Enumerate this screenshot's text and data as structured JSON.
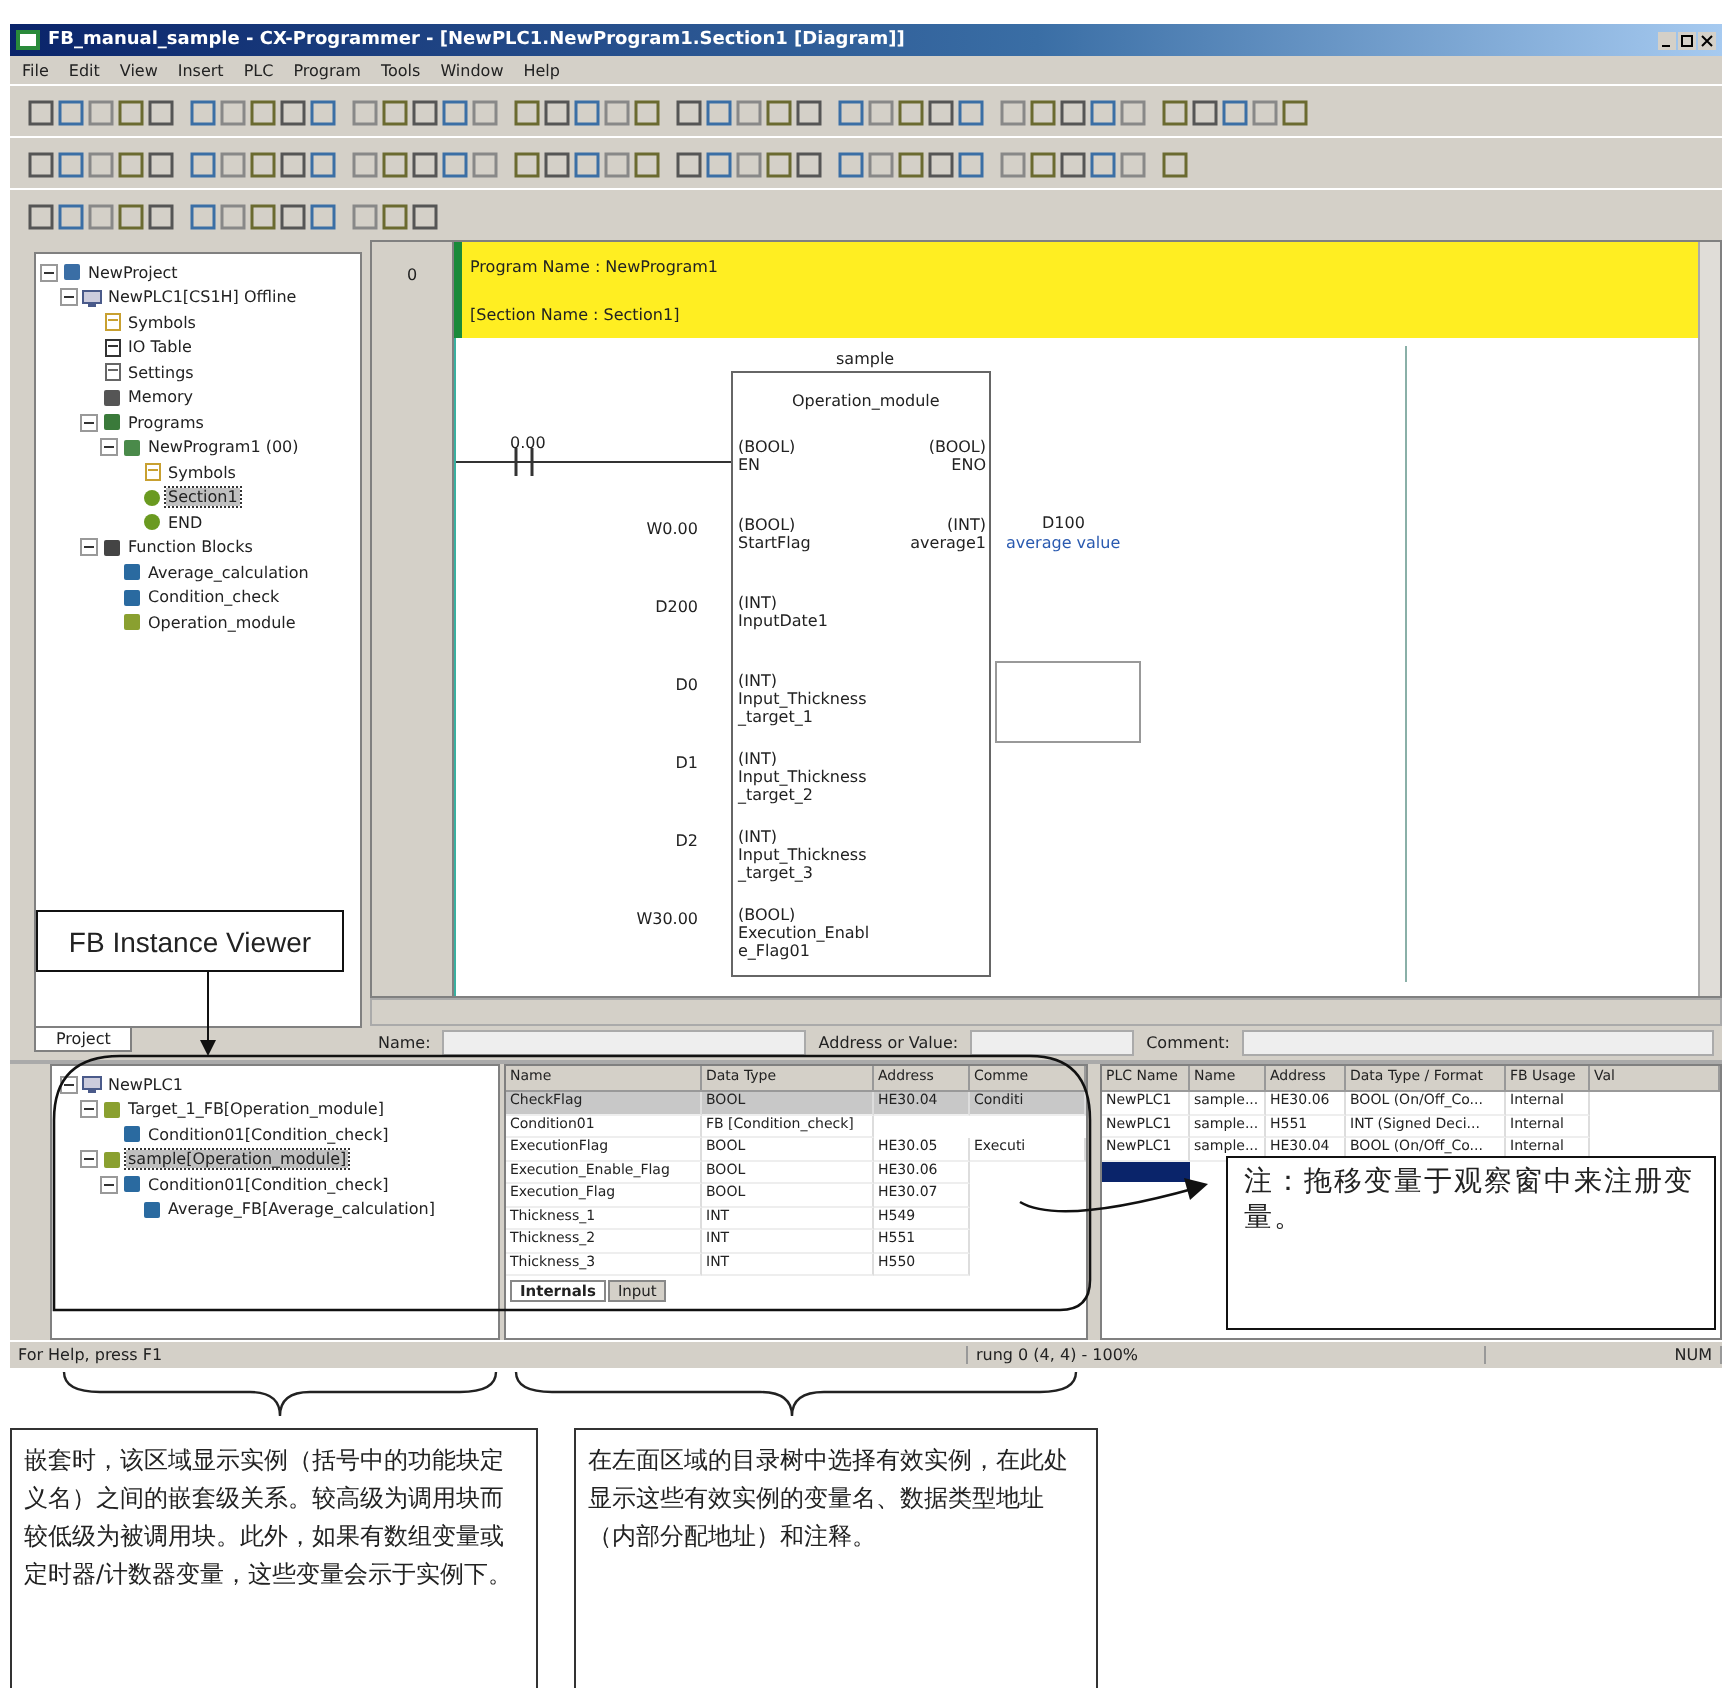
{
  "window": {
    "title": "FB_manual_sample - CX-Programmer - [NewPLC1.NewProgram1.Section1 [Diagram]]"
  },
  "menu": [
    "File",
    "Edit",
    "View",
    "Insert",
    "PLC",
    "Program",
    "Tools",
    "Window",
    "Help"
  ],
  "project_tree": [
    {
      "label": "NewProject",
      "kind": "project",
      "selected": false,
      "expanded": true,
      "children": [
        {
          "label": "NewPLC1[CS1H] Offline",
          "kind": "plc",
          "selected": false,
          "expanded": true,
          "children": [
            {
              "label": "Symbols",
              "kind": "symbols",
              "selected": false
            },
            {
              "label": "IO Table",
              "kind": "table",
              "selected": false
            },
            {
              "label": "Settings",
              "kind": "settings",
              "selected": false
            },
            {
              "label": "Memory",
              "kind": "memory",
              "selected": false
            },
            {
              "label": "Programs",
              "kind": "programs",
              "selected": false,
              "expanded": true,
              "children": [
                {
                  "label": "NewProgram1 (00)",
                  "kind": "program",
                  "selected": false,
                  "expanded": true,
                  "children": [
                    {
                      "label": "Symbols",
                      "kind": "symbols",
                      "selected": false
                    },
                    {
                      "label": "Section1",
                      "kind": "section",
                      "selected": true
                    },
                    {
                      "label": "END",
                      "kind": "section",
                      "selected": false
                    }
                  ]
                }
              ]
            },
            {
              "label": "Function Blocks",
              "kind": "fbfolder",
              "selected": false,
              "expanded": true,
              "children": [
                {
                  "label": "Average_calculation",
                  "kind": "fb",
                  "selected": false
                },
                {
                  "label": "Condition_check",
                  "kind": "fb",
                  "selected": false
                },
                {
                  "label": "Operation_module",
                  "kind": "fbmod",
                  "selected": false
                }
              ]
            }
          ]
        }
      ]
    }
  ],
  "project_tab": "Project",
  "diagram": {
    "program_name": "Program Name : NewProgram1",
    "section_name": "[Section Name : Section1]",
    "rung_number": "0",
    "contact_address": "0.00",
    "block": {
      "instance": "sample",
      "fb_name": "Operation_module",
      "inputs": [
        {
          "type": "(BOOL)",
          "name": "EN"
        },
        {
          "operand": "W0.00",
          "type": "(BOOL)",
          "name": "StartFlag"
        },
        {
          "operand": "D200",
          "type": "(INT)",
          "name": "InputDate1"
        },
        {
          "operand": "D0",
          "type": "(INT)",
          "name": "Input_Thickness_target_1"
        },
        {
          "operand": "D1",
          "type": "(INT)",
          "name": "Input_Thickness_target_2"
        },
        {
          "operand": "D2",
          "type": "(INT)",
          "name": "Input_Thickness_target_3"
        },
        {
          "operand": "W30.00",
          "type": "(BOOL)",
          "name": "Execution_Enable_Flag01"
        }
      ],
      "outputs": [
        {
          "type": "(BOOL)",
          "name": "ENO"
        },
        {
          "type": "(INT)",
          "name": "average1",
          "operand": "D100",
          "comment": "average value"
        }
      ]
    }
  },
  "entry_bar": {
    "name_label": "Name:",
    "address_label": "Address or Value:",
    "comment_label": "Comment:"
  },
  "instance_tree": [
    {
      "label": "NewPLC1",
      "kind": "plc",
      "selected": false,
      "expanded": true,
      "children": [
        {
          "label": "Target_1_FB[Operation_module]",
          "kind": "fbmod",
          "selected": false,
          "expanded": true,
          "children": [
            {
              "label": "Condition01[Condition_check]",
              "kind": "fb",
              "selected": false
            }
          ]
        },
        {
          "label": "sample[Operation_module]",
          "kind": "fbmod",
          "selected": true,
          "expanded": true,
          "children": [
            {
              "label": "Condition01[Condition_check]",
              "kind": "fb",
              "selected": false,
              "expanded": true,
              "children": [
                {
                  "label": "Average_FB[Average_calculation]",
                  "kind": "fb",
                  "selected": false
                }
              ]
            }
          ]
        }
      ]
    }
  ],
  "variables": {
    "columns": [
      "Name",
      "Data Type",
      "Address",
      "Comme"
    ],
    "rows": [
      {
        "cells": [
          "CheckFlag",
          "BOOL",
          "HE30.04",
          "Conditi"
        ],
        "selected": true
      },
      {
        "cells": [
          "Condition01",
          "FB [Condition_check]"
        ],
        "selected": false
      },
      {
        "cells": [
          "ExecutionFlag",
          "BOOL",
          "HE30.05",
          "Executi"
        ],
        "selected": false
      },
      {
        "cells": [
          "Execution_Enable_Flag",
          "BOOL",
          "HE30.06"
        ],
        "selected": false
      },
      {
        "cells": [
          "Execution_Flag",
          "BOOL",
          "HE30.07"
        ],
        "selected": false
      },
      {
        "cells": [
          "Thickness_1",
          "INT",
          "H549"
        ],
        "selected": false
      },
      {
        "cells": [
          "Thickness_2",
          "INT",
          "H551"
        ],
        "selected": false
      },
      {
        "cells": [
          "Thickness_3",
          "INT",
          "H550"
        ],
        "selected": false
      }
    ],
    "tabs": [
      {
        "label": "Internals",
        "selected": true
      },
      {
        "label": "Input",
        "selected": false
      }
    ]
  },
  "watch": {
    "columns": [
      "PLC Name",
      "Name",
      "Address",
      "Data Type / Format",
      "FB Usage",
      "Val"
    ],
    "rows": [
      {
        "cells": [
          "NewPLC1",
          "sample...",
          "HE30.06",
          "BOOL (On/Off_Co...",
          "Internal"
        ],
        "selected": false
      },
      {
        "cells": [
          "NewPLC1",
          "sample...",
          "H551",
          "INT (Signed Deci...",
          "Internal"
        ],
        "selected": false
      },
      {
        "cells": [
          "NewPLC1",
          "sample...",
          "HE30.04",
          "BOOL (On/Off_Co...",
          "Internal"
        ],
        "selected": false
      },
      {
        "selected": true
      }
    ]
  },
  "status_bar": [
    "For Help, press F1",
    "rung 0 (4, 4) - 100%",
    "NUM"
  ],
  "annotations": {
    "viewer_label": "FB Instance Viewer",
    "note": "注：拖移变量于观察窗中来注册变量。",
    "left_caption": "嵌套时，该区域显示实例（括号中的功能块定义名）之间的嵌套级关系。较高级为调用块而较低级为被调用块。此外，如果有数组变量或定时器/计数器变量，这些变量会示于实例下。",
    "right_caption": "在左面区域的目录树中选择有效实例，在此处显示这些有效实例的变量名、数据类型地址（内部分配地址）和注释。"
  }
}
